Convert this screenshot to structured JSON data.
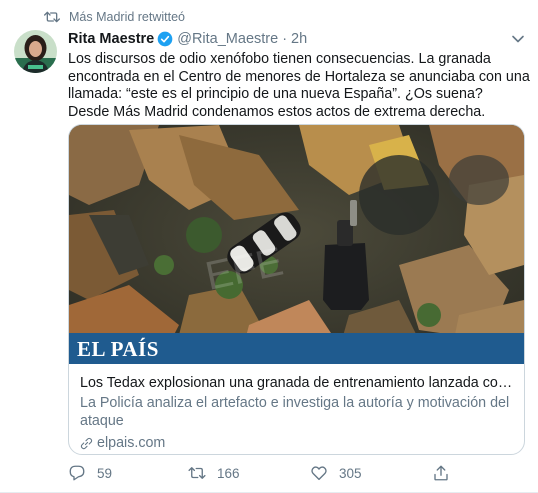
{
  "retweet_context": {
    "label": "Más Madrid retwitteó"
  },
  "author": {
    "name": "Rita Maestre",
    "handle": "@Rita_Maestre",
    "separator": "·",
    "time": "2h"
  },
  "tweet": {
    "lines": [
      "Los discursos de odio xenófobo tienen consecuencias. La granada",
      "encontrada en el Centro de menores de Hortaleza se anunciaba con una",
      "llamada: “este es el principio de una nueva España”. ¿Os suena?",
      "Desde Más Madrid condenamos estos actos de extrema derecha."
    ]
  },
  "card": {
    "brand": "EL PAÍS",
    "watermark": "EFE",
    "title": "Los Tedax explosionan una granada de entrenamiento lanzada contra el...",
    "description": "La Policía analiza el artefacto e investiga la autoría y motivación del ataque",
    "domain": "elpais.com"
  },
  "actions": {
    "replies": "59",
    "retweets": "166",
    "likes": "305"
  },
  "colors": {
    "text": "#14171a",
    "secondary": "#657786",
    "border": "#ccd6dd",
    "verified": "#1da1f2",
    "brand_bar": "#1f5b8f"
  },
  "icons": [
    "retweet-icon",
    "verified-badge-icon",
    "chevron-down-icon",
    "link-icon",
    "reply-icon",
    "like-icon",
    "share-icon"
  ]
}
